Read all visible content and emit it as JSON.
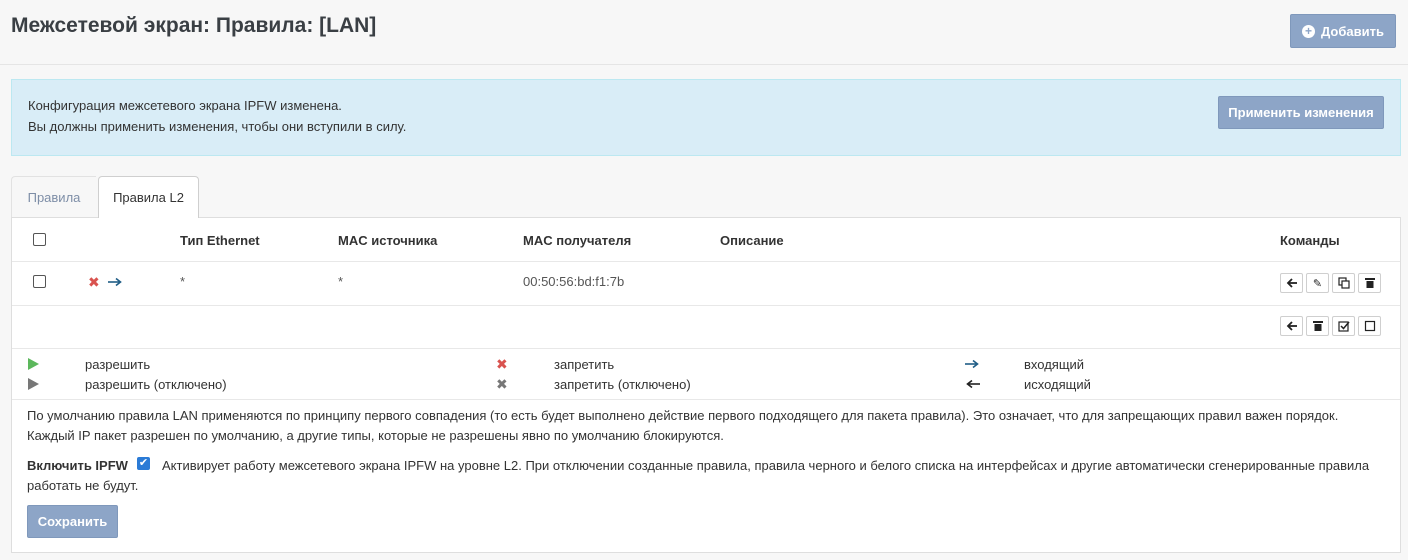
{
  "header": {
    "title": "Межсетевой экран: Правила: [LAN]",
    "add_label": "Добавить"
  },
  "alert": {
    "line1": "Конфигурация межсетевого экрана IPFW изменена.",
    "line2": "Вы должны применить изменения, чтобы они вступили в силу.",
    "apply_label": "Применить изменения"
  },
  "tabs": {
    "rules": "Правила",
    "rules_l2": "Правила L2"
  },
  "table": {
    "columns": {
      "ethernet_type": "Тип Ethernet",
      "mac_source": "MAC источника",
      "mac_dest": "MAC получателя",
      "description": "Описание",
      "commands": "Команды"
    },
    "rows": [
      {
        "ethernet_type": "*",
        "mac_source": "*",
        "mac_dest": "00:50:56:bd:f1:7b",
        "description": ""
      }
    ]
  },
  "legend": {
    "allow": "разрешить",
    "allow_disabled": "разрешить (отключено)",
    "deny": "запретить",
    "deny_disabled": "запретить (отключено)",
    "incoming": "входящий",
    "outgoing": "исходящий"
  },
  "notes": {
    "line1": "По умолчанию правила LAN применяются по принципу первого совпадения (то есть будет выполнено действие первого подходящего для пакета правила). Это означает, что для запрещающих правил важен порядок.",
    "line2": "Каждый IP пакет разрешен по умолчанию, а другие типы, которые не разрешены явно по умолчанию блокируются."
  },
  "enable": {
    "label": "Включить IPFW",
    "desc1": "Активирует работу межсетевого экрана IPFW на уровне L2. При отключении созданные правила, правила черного и белого списка на интерфейсах и другие автоматически сгенерированные правила",
    "desc2": "работать не будут.",
    "checked": true
  },
  "save_label": "Сохранить",
  "colors": {
    "button": "#8da5c7",
    "alert_bg": "#d9edf7",
    "deny": "#d9534f",
    "allow": "#5cb85c",
    "disabled": "#777777",
    "direction": "#1f5d86"
  }
}
